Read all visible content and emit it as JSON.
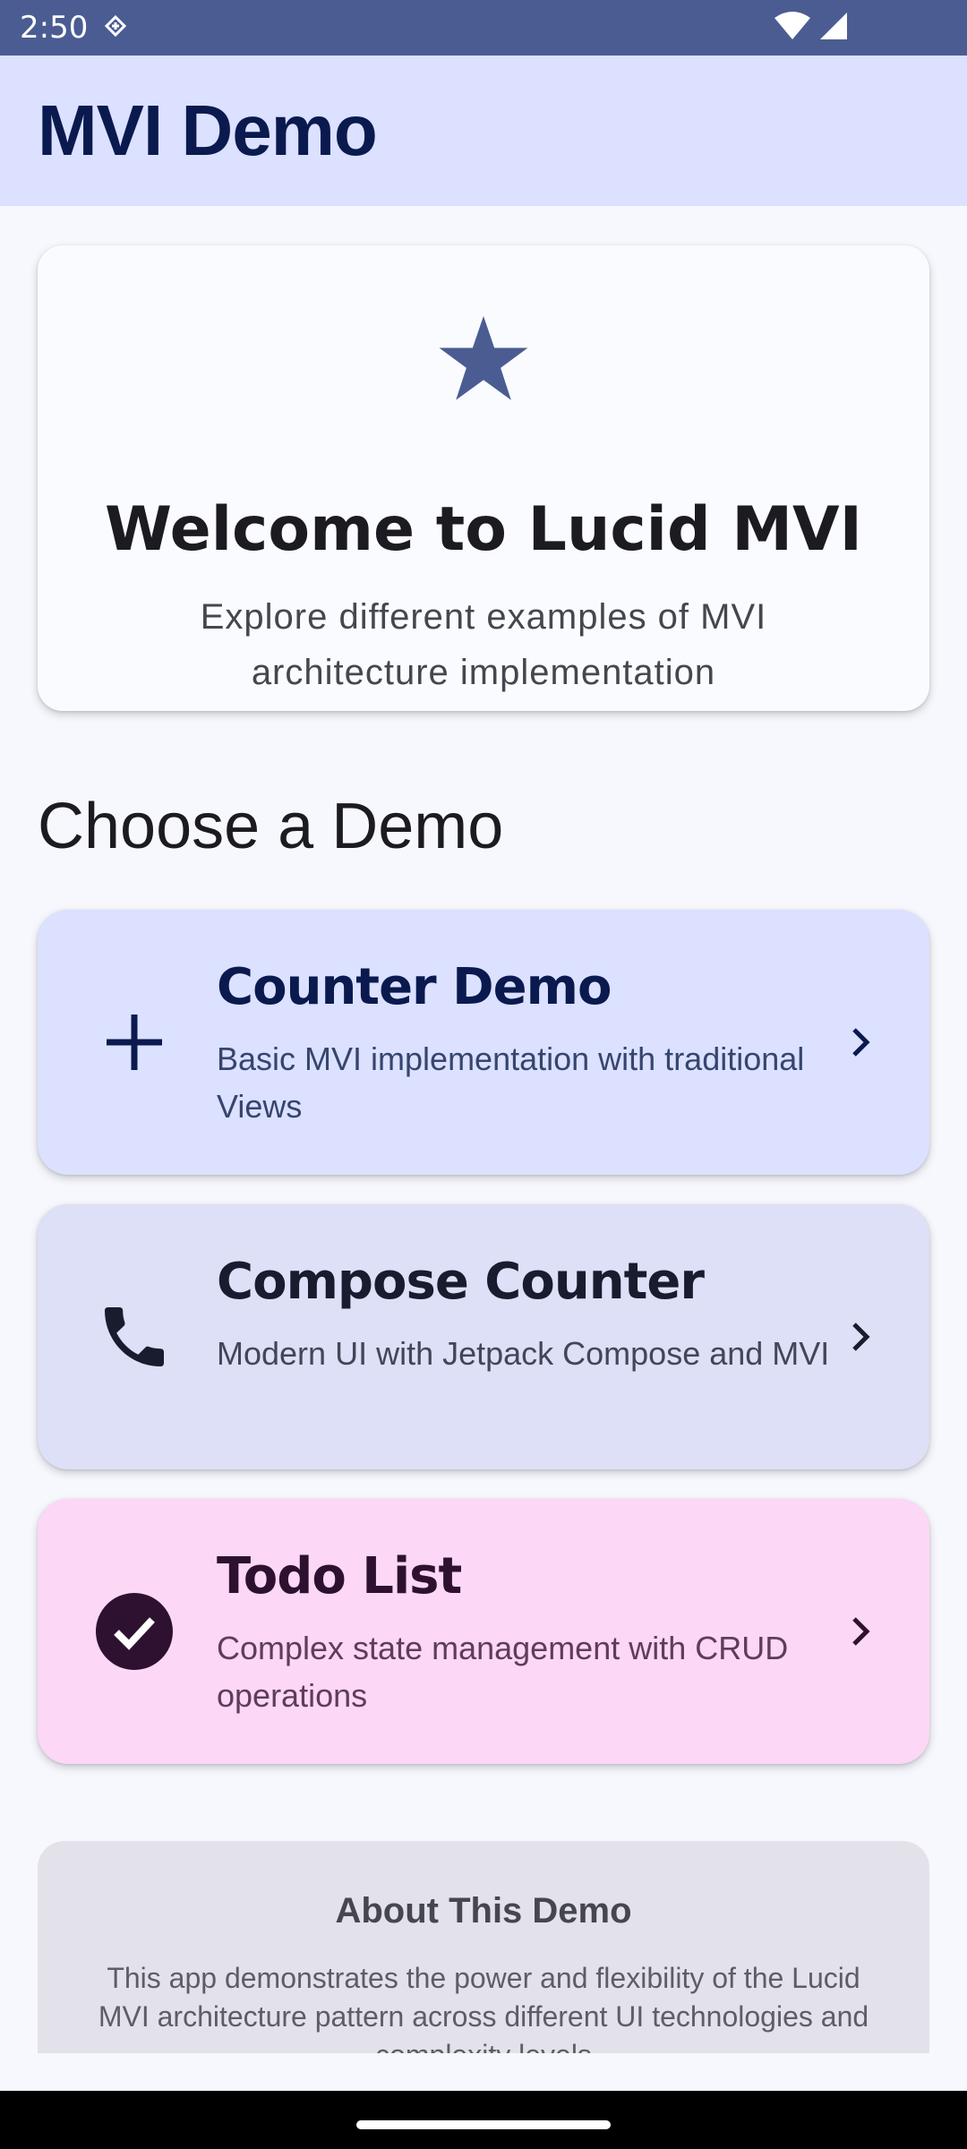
{
  "status_bar": {
    "time": "2:50",
    "left_icon": "data-saver-icon",
    "right_icons": [
      "wifi-icon",
      "cell-signal-icon"
    ],
    "color": "#4b5c92"
  },
  "app_bar": {
    "title": "MVI Demo",
    "background": "#dbe1ff"
  },
  "welcome": {
    "icon": "star-icon",
    "title": "Welcome to Lucid MVI",
    "subtitle": "Explore different examples of MVI architecture implementation"
  },
  "section_title": "Choose a Demo",
  "demos": [
    {
      "title": "Counter Demo",
      "description": "Basic MVI implementation with traditional Views",
      "icon": "plus-icon",
      "background": "#dbe1ff"
    },
    {
      "title": "Compose Counter",
      "description": "Modern UI with Jetpack Compose and MVI",
      "icon": "phone-icon",
      "background": "#dde0f6"
    },
    {
      "title": "Todo List",
      "description": "Complex state management with CRUD operations",
      "icon": "check-circle-icon",
      "background": "#fcd7f6"
    }
  ],
  "about": {
    "title": "About This Demo",
    "text": "This app demonstrates the power and flexibility of the Lucid MVI architecture pattern across different UI technologies and complexity levels"
  },
  "colors": {
    "accent": "#4b5c92",
    "background": "#f7f8fd"
  }
}
